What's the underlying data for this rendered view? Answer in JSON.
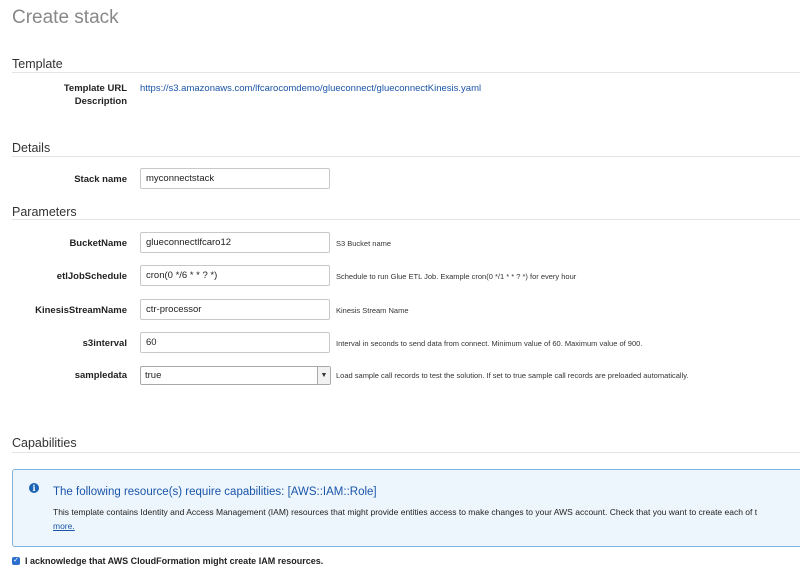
{
  "page": {
    "title": "Create stack"
  },
  "template_section": {
    "title": "Template",
    "url_label": "Template URL",
    "url_value": "https://s3.amazonaws.com/lfcarocomdemo/glueconnect/glueconnectKinesis.yaml",
    "description_label": "Description"
  },
  "details_section": {
    "title": "Details",
    "stack_name_label": "Stack name",
    "stack_name_value": "myconnectstack"
  },
  "parameters_section": {
    "title": "Parameters",
    "params": [
      {
        "label": "BucketName",
        "value": "glueconnectlfcaro12",
        "help": "S3 Bucket name"
      },
      {
        "label": "etlJobSchedule",
        "value": "cron(0 */6 * * ? *)",
        "help": "Schedule to run Glue ETL Job. Example cron(0 */1 * * ? *) for every hour"
      },
      {
        "label": "KinesisStreamName",
        "value": "ctr-processor",
        "help": "Kinesis Stream Name"
      },
      {
        "label": "s3interval",
        "value": "60",
        "help": "Interval in seconds to send data from connect. Minimum value of 60. Maximum value of 900."
      },
      {
        "label": "sampledata",
        "value": "true",
        "help": "Load sample call records to test the solution. If set to true sample call records are preloaded automatically."
      }
    ]
  },
  "capabilities_section": {
    "title": "Capabilities",
    "alert_title": "The following resource(s) require capabilities: [AWS::IAM::Role]",
    "alert_body": "This template contains Identity and Access Management (IAM) resources that might provide entities access to make changes to your AWS account. Check that you want to create each of t",
    "alert_more": "more.",
    "acknowledge_label": "I acknowledge that AWS CloudFormation might create IAM resources."
  },
  "icons": {
    "info": "info-circle-icon",
    "checkbox": "check-icon",
    "dropdown": "caret-down-icon"
  },
  "colors": {
    "link": "#1a55a8",
    "alert_bg": "#eef6fd",
    "alert_border": "#7fb3dd",
    "checkbox": "#2c6fce"
  }
}
